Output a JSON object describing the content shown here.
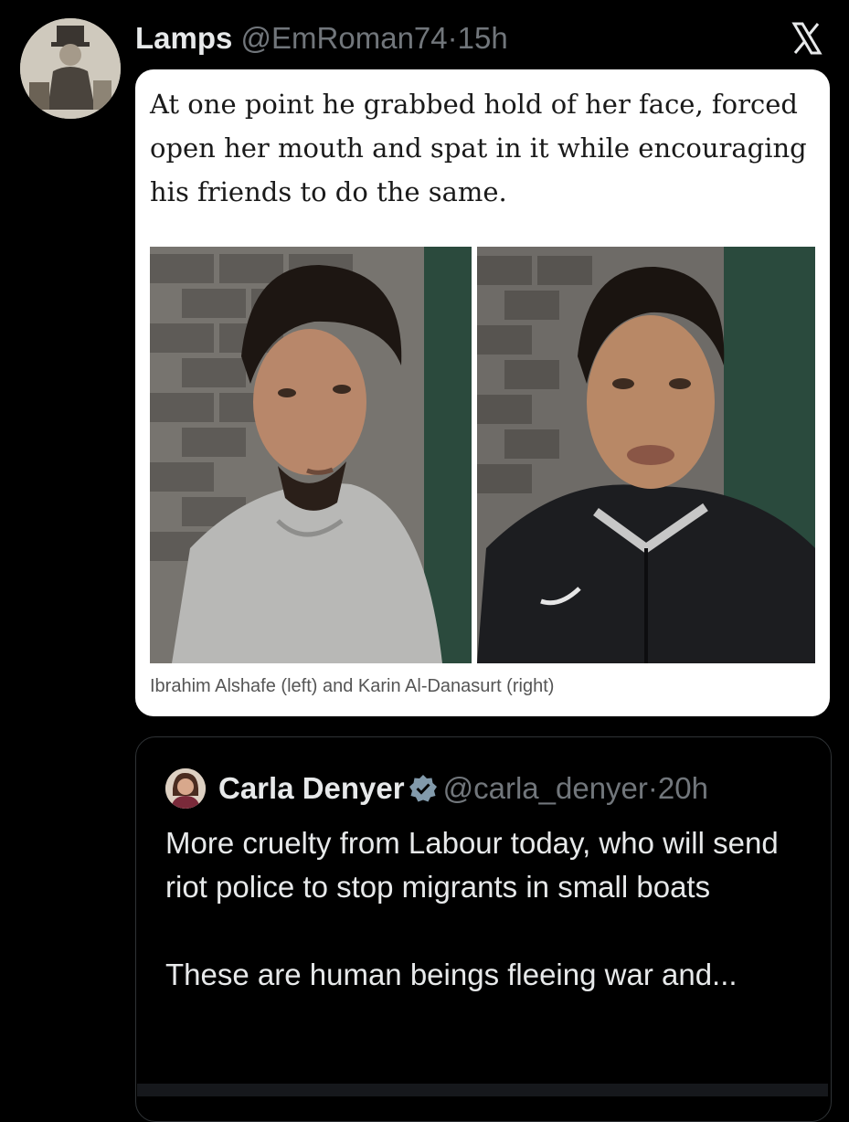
{
  "tweet": {
    "author_name": "Lamps",
    "handle": "@EmRoman74",
    "separator": "·",
    "time": "15h",
    "brand_icon": "x-logo-icon",
    "card": {
      "quote": "At one point he grabbed hold of her face, forced open her mouth and spat in it while encouraging his friends to do the same.",
      "caption": "Ibrahim Alshafe (left) and Karin Al-Danasurt (right)"
    }
  },
  "quoted_tweet": {
    "author_name": "Carla Denyer",
    "handle": "@carla_denyer",
    "separator": "·",
    "time": "20h",
    "verified_icon": "verified-badge-icon",
    "paragraph_1": "More cruelty from Labour today, who will send riot police to stop migrants in small boats",
    "paragraph_2": "These are human beings fleeing war and..."
  },
  "colors": {
    "background": "#000000",
    "text": "#e7e9ea",
    "muted": "#71767b",
    "border": "#2f3336",
    "verified": "#829aab"
  }
}
